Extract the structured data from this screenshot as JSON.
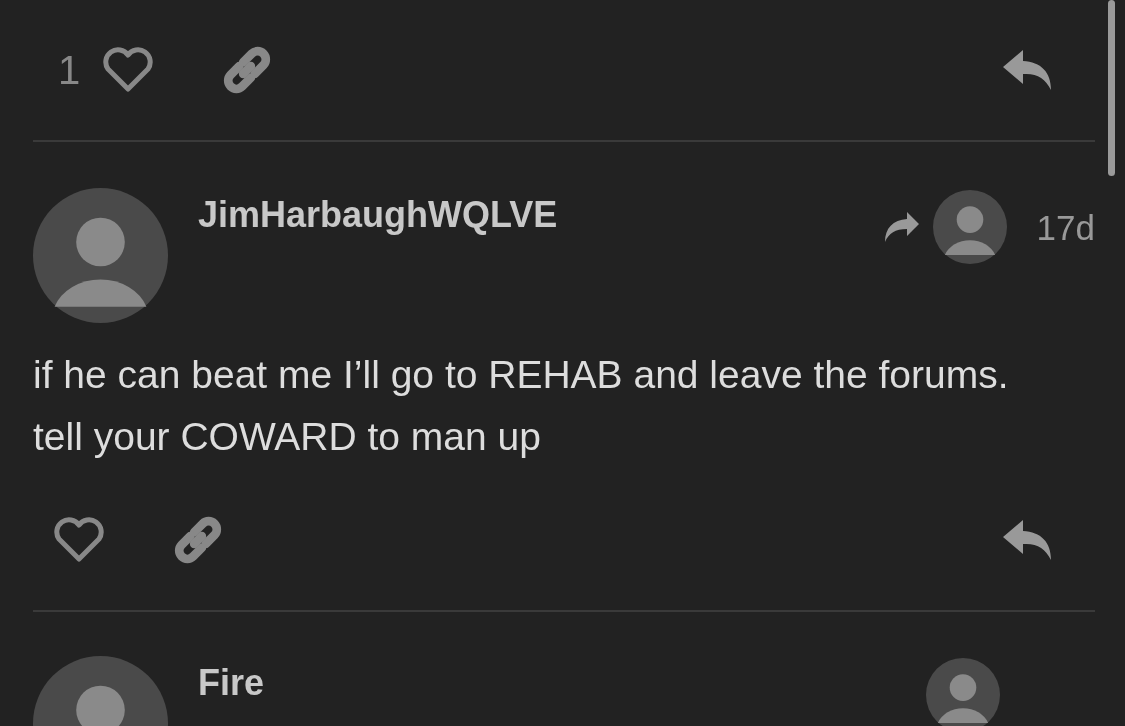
{
  "previous_post": {
    "like_count": "1",
    "liked": false
  },
  "post": {
    "username": "JimHarbaughWQLVE",
    "time": "17d",
    "text": "if he can beat me I’ll go to REHAB and leave the forums. tell your COWARD to man up",
    "liked": false
  },
  "next_post": {
    "username": "Fire"
  }
}
